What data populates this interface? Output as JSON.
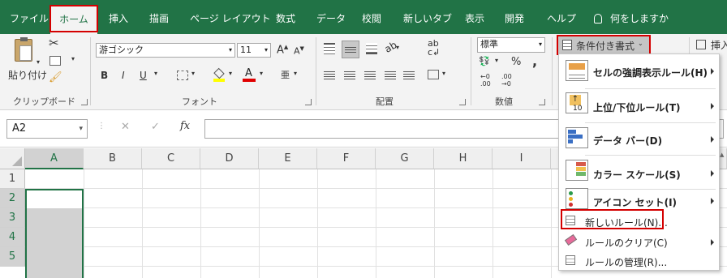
{
  "tabs": [
    "ファイル",
    "ホーム",
    "挿入",
    "描画",
    "ページ レイアウト",
    "数式",
    "データ",
    "校閲",
    "新しいタブ",
    "表示",
    "開発",
    "ヘルプ"
  ],
  "tell_me": "何をしますか",
  "clipboard": {
    "paste_label": "貼り付け",
    "group_label": "クリップボード"
  },
  "font": {
    "name": "游ゴシック",
    "size": "11",
    "group_label": "フォント",
    "bold": "B",
    "italic": "I",
    "underline": "U",
    "grow": "A",
    "shrink": "A"
  },
  "alignment": {
    "group_label": "配置"
  },
  "number": {
    "format": "標準",
    "group_label": "数値",
    "percent": "%",
    "comma": ","
  },
  "styles": {
    "cond_format_label": "条件付き書式"
  },
  "cells": {
    "insert_label": "挿入"
  },
  "formula_bar": {
    "name_box": "A2",
    "fx": "fx"
  },
  "columns": [
    "A",
    "B",
    "C",
    "D",
    "E",
    "F",
    "G",
    "H",
    "I"
  ],
  "rows": [
    "1",
    "2",
    "3",
    "4",
    "5"
  ],
  "menu": {
    "items": [
      {
        "label": "セルの強調表示ルール(H)"
      },
      {
        "label": "上位/下位ルール(T)"
      },
      {
        "label": "データ バー(D)"
      },
      {
        "label": "カラー スケール(S)"
      },
      {
        "label": "アイコン セット(I)"
      },
      {
        "label": "新しいルール(N)..."
      },
      {
        "label": "ルールのクリア(C)"
      },
      {
        "label": "ルールの管理(R)..."
      }
    ]
  },
  "colors": {
    "excel_green": "#217346",
    "highlight_red": "#d40000",
    "selection_gray": "#d2d2d2"
  }
}
